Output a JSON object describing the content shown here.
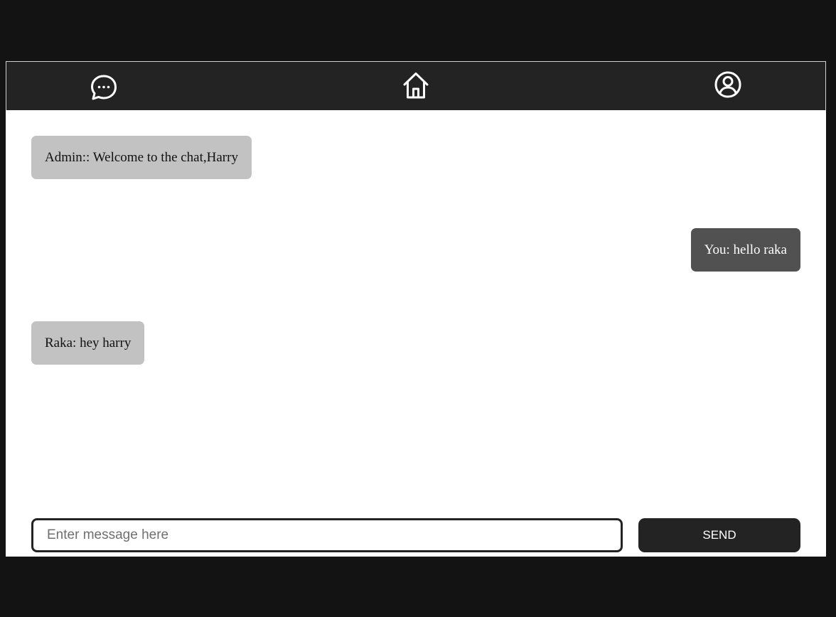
{
  "navbar": {
    "items": [
      {
        "icon": "chat-bubble-icon"
      },
      {
        "icon": "home-icon"
      },
      {
        "icon": "user-profile-icon"
      }
    ]
  },
  "messages": [
    {
      "direction": "incoming",
      "text": "Admin:: Welcome to the chat,Harry"
    },
    {
      "direction": "outgoing",
      "text": "You: hello raka"
    },
    {
      "direction": "incoming",
      "text": "Raka: hey harry"
    }
  ],
  "composer": {
    "value": "",
    "placeholder": "Enter message here",
    "send_label": "SEND"
  },
  "colors": {
    "page_background": "#131313",
    "navbar_background": "#232323",
    "incoming_bubble": "#c2c2c2",
    "outgoing_bubble": "#515151",
    "send_button": "#232323"
  }
}
